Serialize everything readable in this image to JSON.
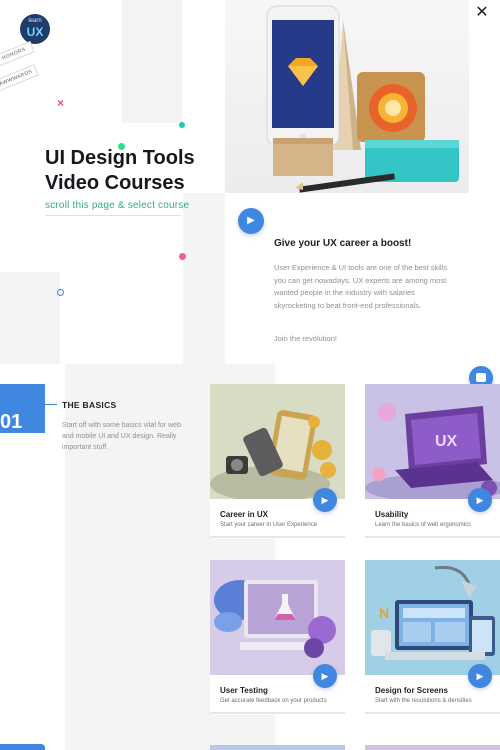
{
  "logo": {
    "line1": "learn",
    "line2": "UX"
  },
  "awards": [
    "HONORS",
    "AWWWARDS"
  ],
  "hero": {
    "title_line1": "UI Design Tools",
    "title_line2": "Video Courses",
    "subtitle": "scroll this page & select course"
  },
  "close_label": "✕",
  "boost": {
    "title": "Give your UX career a boost!",
    "body": "User Experience & UI tools are one of the best skills you can get nowadays. UX experts are among most wanted people in the industry with salaries skyrocketing to beat front-end professionals.",
    "join": "Join the revolution!"
  },
  "section": {
    "number": "01",
    "title": "THE BASICS",
    "body": "Start off with some basics vital for web and mobile UI and UX design. Really important stuff."
  },
  "cards": [
    {
      "title": "Career in UX",
      "desc": "Start your career in User Experience"
    },
    {
      "title": "Usability",
      "desc": "Learn the basics of web ergonomics"
    },
    {
      "title": "User Testing",
      "desc": "Get accurate feedback on your products"
    },
    {
      "title": "Design for Screens",
      "desc": "Start with the resolutions & densities"
    }
  ],
  "card_illustration_labels": {
    "usability": "UX"
  },
  "icons": {
    "play": "play-icon",
    "close": "close-icon",
    "chat": "chat-icon"
  },
  "colors": {
    "accent_blue": "#3f87e0",
    "accent_green": "#3aa88c",
    "accent_pink": "#e84d8a"
  }
}
